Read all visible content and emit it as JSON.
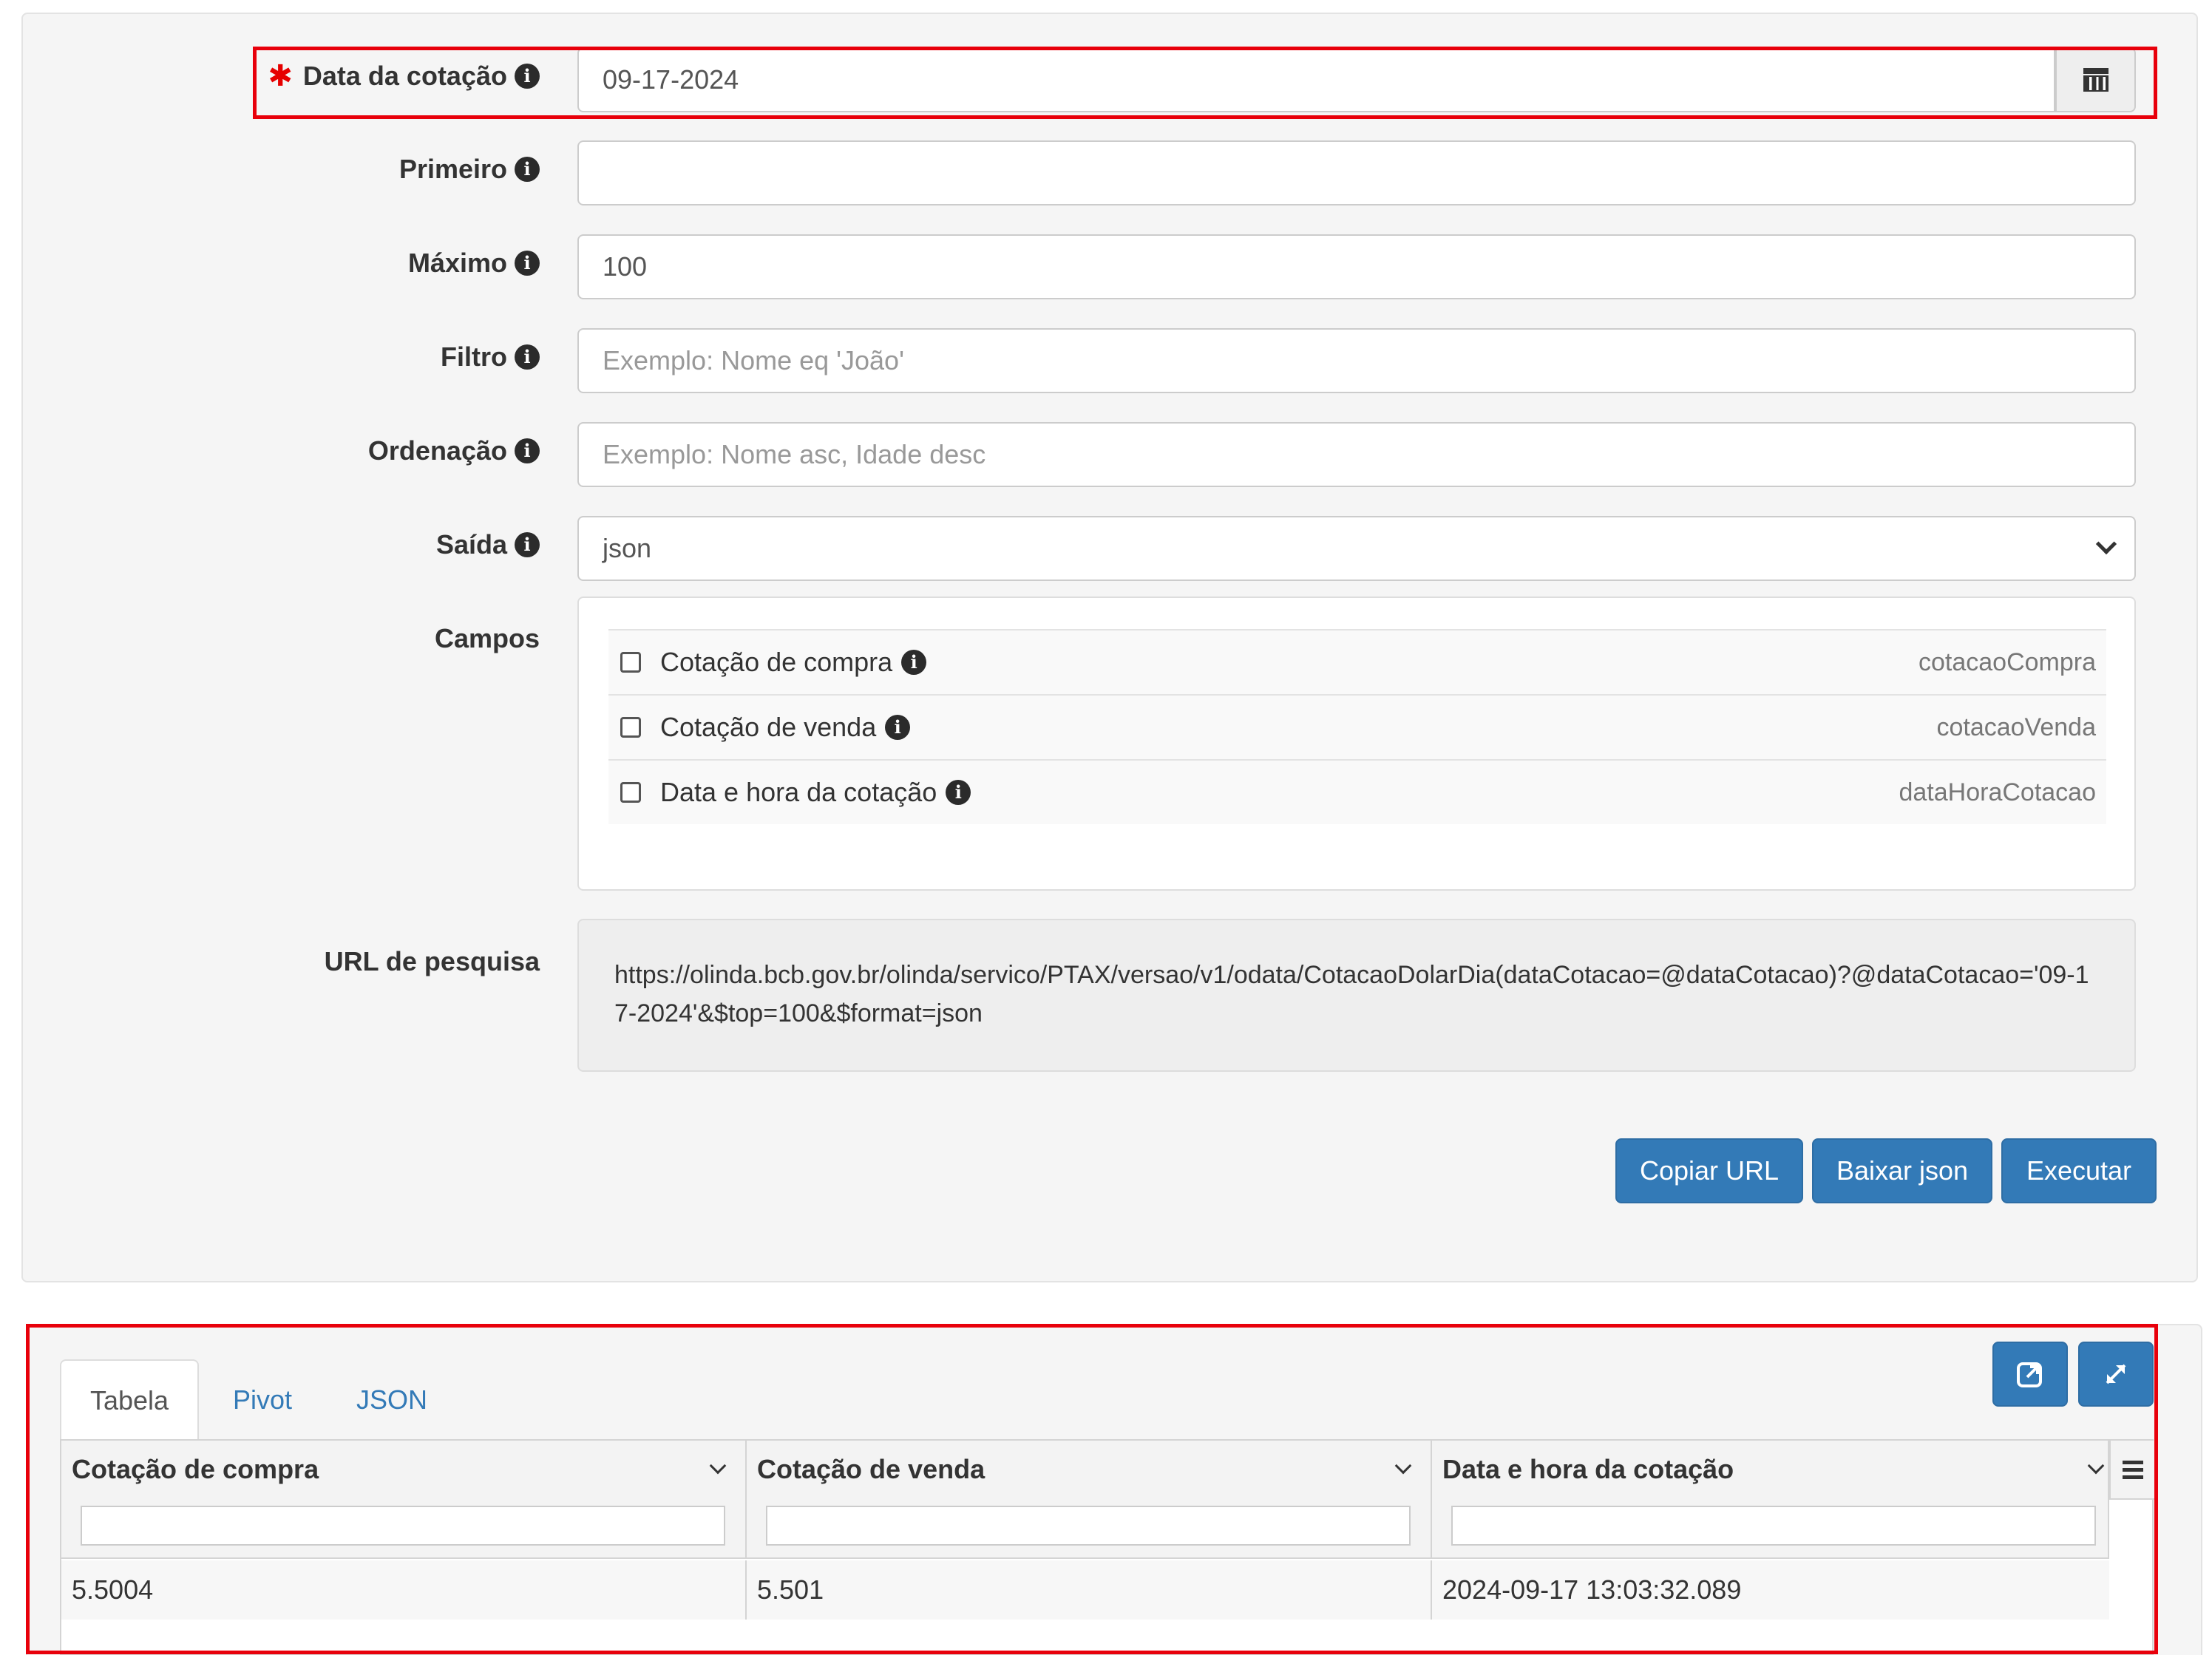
{
  "form": {
    "date": {
      "label": "Data da cotação",
      "value": "09-17-2024",
      "required_mark": "✱"
    },
    "primeiro": {
      "label": "Primeiro",
      "value": ""
    },
    "maximo": {
      "label": "Máximo",
      "value": "100"
    },
    "filtro": {
      "label": "Filtro",
      "placeholder": "Exemplo: Nome eq 'João'"
    },
    "ordenacao": {
      "label": "Ordenação",
      "placeholder": "Exemplo: Nome asc, Idade desc"
    },
    "saida": {
      "label": "Saída",
      "value": "json"
    },
    "campos": {
      "label": "Campos",
      "fields": [
        {
          "label": "Cotação de compra",
          "key": "cotacaoCompra"
        },
        {
          "label": "Cotação de venda",
          "key": "cotacaoVenda"
        },
        {
          "label": "Data e hora da cotação",
          "key": "dataHoraCotacao"
        }
      ]
    },
    "url": {
      "label": "URL de pesquisa",
      "value": "https://olinda.bcb.gov.br/olinda/servico/PTAX/versao/v1/odata/CotacaoDolarDia(dataCotacao=@dataCotacao)?@dataCotacao='09-17-2024'&$top=100&$format=json"
    },
    "buttons": {
      "copy": "Copiar URL",
      "download": "Baixar json",
      "execute": "Executar"
    }
  },
  "results": {
    "tabs": [
      "Tabela",
      "Pivot",
      "JSON"
    ],
    "active_tab": "Tabela",
    "columns": [
      "Cotação de compra",
      "Cotação de venda",
      "Data e hora da cotação"
    ],
    "rows": [
      [
        "5.5004",
        "5.501",
        "2024-09-17 13:03:32.089"
      ]
    ]
  },
  "icons": {
    "info": "info-icon",
    "calendar": "calendar-icon",
    "external": "external-link-icon",
    "expand": "expand-icon",
    "menu": "menu-icon"
  },
  "colors": {
    "primary": "#337ab7",
    "highlight": "#e8000b",
    "required": "#e60000"
  }
}
